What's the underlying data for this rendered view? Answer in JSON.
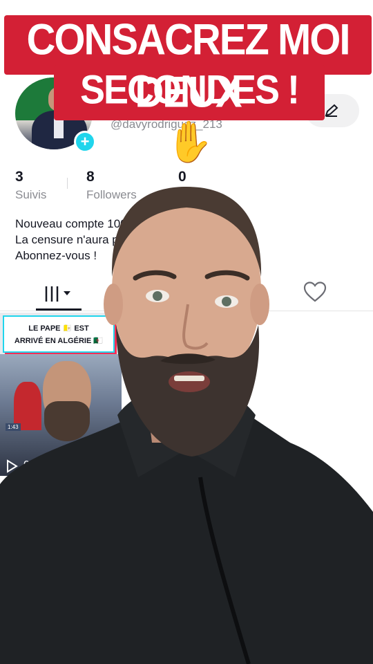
{
  "banner": {
    "line1": "CONSACREZ MOI DEUX",
    "line2": "SECONDES ! ✋",
    "color": "#d32035"
  },
  "profile": {
    "handle": "@davyrodriguez_213",
    "follow_icon": "plus-icon",
    "edit_icon": "pencil-icon",
    "stats": [
      {
        "value": "3",
        "label": "Suivis"
      },
      {
        "value": "8",
        "label": "Followers"
      },
      {
        "value": "0",
        "label": ""
      }
    ],
    "bio": [
      "Nouveau compte 100",
      "La censure n'aura p",
      "Abonnez-vous !"
    ]
  },
  "tabs": {
    "videos_icon": "grid-icon",
    "liked_icon": "heart-icon"
  },
  "video_thumb": {
    "caption_line1": "LE PAPE 🇻🇦 EST",
    "caption_line2": "ARRIVÉ EN ALGÉRIE 🇩🇿",
    "duration": "1:43",
    "play_icon": "play-icon",
    "play_count": "0"
  },
  "accent_colors": {
    "tiktok_cyan": "#20d5ec",
    "tiktok_red": "#fe2c55"
  }
}
